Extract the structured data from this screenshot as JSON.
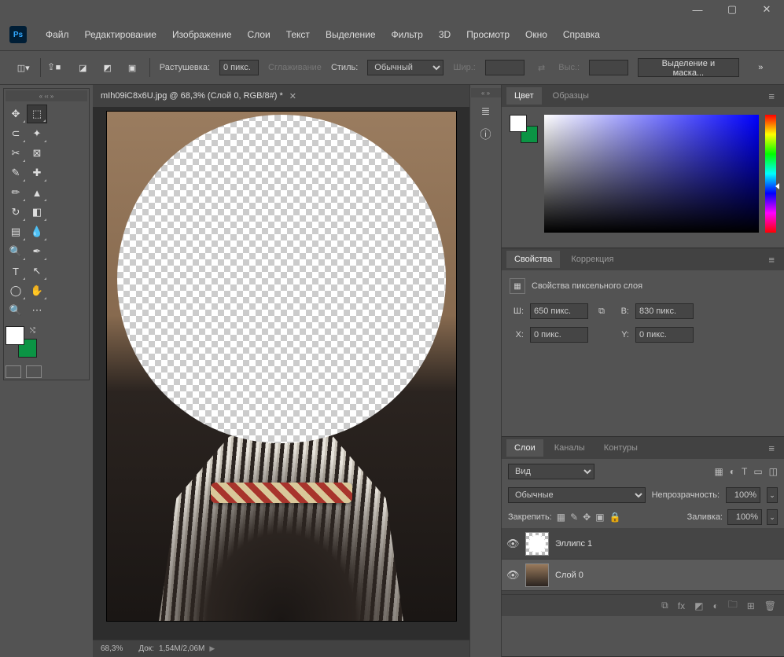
{
  "window": {
    "min": "—",
    "max": "▢",
    "close": "✕"
  },
  "app": {
    "logo": "Ps"
  },
  "menu": {
    "file": "Файл",
    "edit": "Редактирование",
    "image": "Изображение",
    "layers": "Слои",
    "type": "Текст",
    "select": "Выделение",
    "filter": "Фильтр",
    "three_d": "3D",
    "view": "Просмотр",
    "window": "Окно",
    "help": "Справка"
  },
  "options": {
    "feather_label": "Растушевка:",
    "feather_value": "0 пикс.",
    "antialias": "Сглаживание",
    "style_label": "Стиль:",
    "style_value": "Обычный",
    "width_label": "Шир.:",
    "width_value": "",
    "height_label": "Выс.:",
    "height_value": "",
    "select_mask": "Выделение и маска..."
  },
  "document": {
    "tab_title": "mIh09iC8x6U.jpg @ 68,3% (Слой 0, RGB/8#) *"
  },
  "statusbar": {
    "zoom": "68,3%",
    "doc_label": "Док:",
    "doc_size": "1,54M/2,06M"
  },
  "panels": {
    "color": {
      "tab_color": "Цвет",
      "tab_swatches": "Образцы"
    },
    "properties": {
      "tab_props": "Свойства",
      "tab_adjust": "Коррекция",
      "title": "Свойства пиксельного слоя",
      "w_label": "Ш:",
      "w_value": "650 пикс.",
      "h_label": "В:",
      "h_value": "830 пикс.",
      "x_label": "X:",
      "x_value": "0 пикс.",
      "y_label": "Y:",
      "y_value": "0 пикс."
    },
    "layers": {
      "tab_layers": "Слои",
      "tab_channels": "Каналы",
      "tab_paths": "Контуры",
      "kind_prefix": "🔍",
      "kind_value": "Вид",
      "blend_value": "Обычные",
      "opacity_label": "Непрозрачность:",
      "opacity_value": "100%",
      "lock_label": "Закрепить:",
      "fill_label": "Заливка:",
      "fill_value": "100%",
      "items": [
        {
          "name": "Эллипс 1"
        },
        {
          "name": "Слой 0"
        }
      ]
    }
  },
  "colors": {
    "fg": "#ffffff",
    "bg": "#0b9444"
  }
}
